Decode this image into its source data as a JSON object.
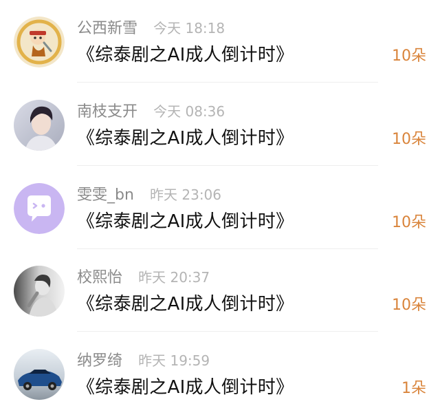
{
  "entries": [
    {
      "username": "公西新雪",
      "time": "今天 18:18",
      "book": "《综泰剧之AI成人倒计时》",
      "gift": "10朵",
      "avatar_icon": "cartoon-pirate-avatar"
    },
    {
      "username": "南枝支开",
      "time": "今天 08:36",
      "book": "《综泰剧之AI成人倒计时》",
      "gift": "10朵",
      "avatar_icon": "portrait-photo-avatar"
    },
    {
      "username": "雯雯_bn",
      "time": "昨天 23:06",
      "book": "《综泰剧之AI成人倒计时》",
      "gift": "10朵",
      "avatar_icon": "chat-bubble-avatar"
    },
    {
      "username": "校熙怡",
      "time": "昨天 20:37",
      "book": "《综泰剧之AI成人倒计时》",
      "gift": "10朵",
      "avatar_icon": "grayscale-portrait-avatar"
    },
    {
      "username": "纳罗绮",
      "time": "昨天 19:59",
      "book": "《综泰剧之AI成人倒计时》",
      "gift": "1朵",
      "avatar_icon": "blue-car-avatar"
    }
  ],
  "colors": {
    "gift": "#d9843b",
    "username": "#8a8a8a",
    "time": "#b4b4b4",
    "title": "#111111",
    "divider": "#eeeeee",
    "chat_avatar_bg": "#c9b6f2"
  }
}
